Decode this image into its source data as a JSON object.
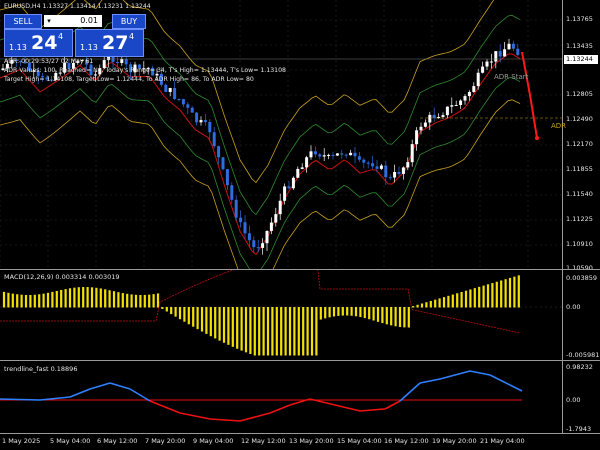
{
  "symbol_header": "EURUSD,H4  1.13327 1.13414 1.13231 1.13244",
  "trade": {
    "sell_label": "SELL",
    "buy_label": "BUY",
    "lot_value": "0.01",
    "lot_arrow": "▾",
    "sell_price_prefix": "1.13",
    "sell_price_big": "24",
    "sell_price_sup": "4",
    "buy_price_prefix": "1.13",
    "buy_price_big": "27",
    "buy_price_sup": "4"
  },
  "adr_info": {
    "line1": "ADR: 00:29:53/27 02 May 61",
    "line2": "ADR Values: 100, Reached= No, Today's Range= 34, T's High= 1.13444, T's Low= 1.13108",
    "line3": "Target High= 1.14108, Target Low= 1.12444, To ADR High= 86, To ADR Low= 80"
  },
  "price_axis": [
    "1.13765",
    "1.13435",
    "1.13244",
    "1.12805",
    "1.12490",
    "1.12170",
    "1.11855",
    "1.11540",
    "1.11225",
    "1.10910",
    "1.10590"
  ],
  "current_price": "1.13244",
  "adr_start_label": "ADR Start",
  "adr_right_label": "ADR",
  "macd": {
    "label": "MACD(12,26,9) 0.003314 0.003019",
    "axis": [
      "0.003859",
      "0.00",
      "-0.005981"
    ]
  },
  "trendline": {
    "label": "trendline_fast 0.18896",
    "axis": [
      "0.98232",
      "0.00",
      "-1.7943"
    ]
  },
  "time_axis": [
    "1 May 2025",
    "5 May 04:00",
    "6 May 12:00",
    "7 May 20:00",
    "9 May 04:00",
    "12 May 12:00",
    "13 May 20:00",
    "15 May 04:00",
    "16 May 12:00",
    "19 May 20:00",
    "21 May 04:00"
  ],
  "colors": {
    "bull": "#ffffff",
    "bear": "#2f6de0",
    "bands": "#2f8a2f",
    "adr_line": "#c8a020",
    "ma_red": "#cc1111",
    "macd_hist": "#f2e000",
    "trend_blue": "#2f80ff",
    "trend_red": "#ee1111",
    "panel_blue": "#1a47c8"
  }
}
